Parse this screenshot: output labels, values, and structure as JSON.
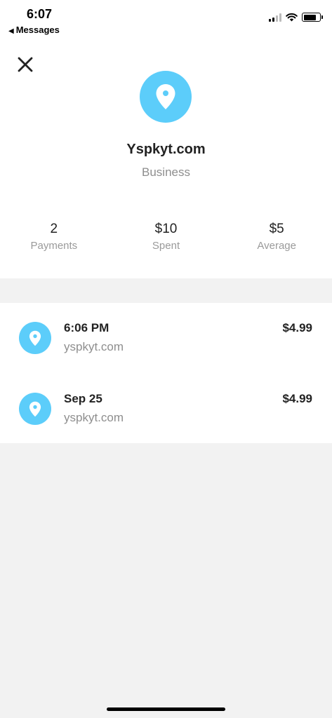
{
  "status_bar": {
    "time": "6:07",
    "back_app": "Messages",
    "icons": [
      "cellular-signal-icon",
      "wifi-icon",
      "battery-icon"
    ]
  },
  "header": {
    "close_icon": "close-icon",
    "avatar_icon": "location-pin-icon",
    "business_name": "Yspkyt.com",
    "business_type": "Business",
    "stats": [
      {
        "value": "2",
        "label": "Payments"
      },
      {
        "value": "$10",
        "label": "Spent"
      },
      {
        "value": "$5",
        "label": "Average"
      }
    ]
  },
  "transactions": [
    {
      "title": "6:06 PM",
      "subtitle": "yspkyt.com",
      "amount": "$4.99",
      "icon": "location-pin-icon"
    },
    {
      "title": "Sep 25",
      "subtitle": "yspkyt.com",
      "amount": "$4.99",
      "icon": "location-pin-icon"
    }
  ],
  "colors": {
    "accent": "#5ccdfa",
    "background": "#f2f2f2",
    "card": "#ffffff",
    "muted_text": "#8e8e8e"
  }
}
